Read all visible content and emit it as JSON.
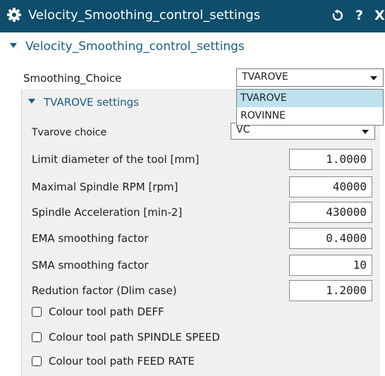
{
  "window": {
    "title": "Velocity_Smoothing_control_settings",
    "reset_icon": "reset-icon",
    "help_label": "?",
    "close_label": "X"
  },
  "section": {
    "label": "Velocity_Smoothing_control_settings"
  },
  "smoothing_choice": {
    "label": "Smoothing_Choice",
    "value": "TVAROVE",
    "options": [
      "TVAROVE",
      "ROVINNE"
    ],
    "open": true
  },
  "subsection": {
    "label": "TVAROVE settings"
  },
  "tvarove_choice": {
    "label": "Tvarove choice",
    "value": "VC"
  },
  "fields": [
    {
      "label": "Limit diameter of the tool [mm]",
      "value": "1.0000"
    },
    {
      "label": "Maximal Spindle RPM [rpm]",
      "value": "40000"
    },
    {
      "label": "Spindle Acceleration [min-2]",
      "value": "430000"
    },
    {
      "label": "EMA smoothing factor",
      "value": "0.4000"
    },
    {
      "label": "SMA smoothing factor",
      "value": "10"
    },
    {
      "label": "Redution factor (Dlim case)",
      "value": "1.2000"
    }
  ],
  "checkboxes": [
    {
      "label": "Colour tool path DEFF",
      "checked": false
    },
    {
      "label": "Colour tool path SPINDLE SPEED",
      "checked": false
    },
    {
      "label": "Colour tool path FEED RATE",
      "checked": false
    }
  ],
  "colors": {
    "titlebar": "#0e4d6b",
    "accent": "#1b5d84",
    "selected_option": "#bde2ee",
    "panel": "#f0f0f0"
  }
}
